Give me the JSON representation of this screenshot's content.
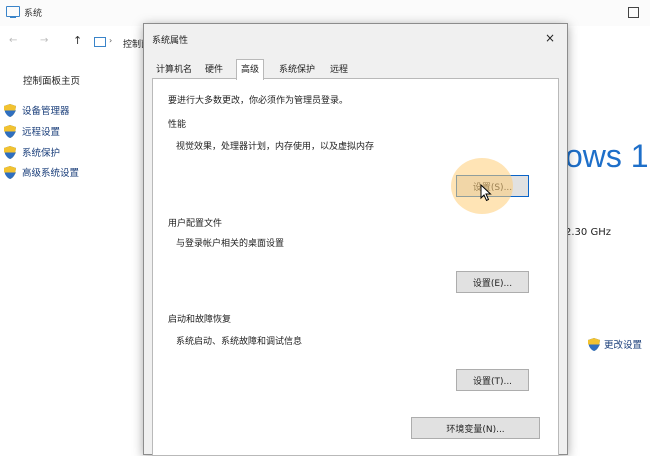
{
  "background": {
    "window_title": "系统",
    "address_text": "控制面板",
    "nav_up": "↑",
    "nav_back": "←",
    "nav_forward": "→",
    "sidebar": {
      "home": "控制面板主页",
      "items": [
        {
          "label": "设备管理器"
        },
        {
          "label": "远程设置"
        },
        {
          "label": "系统保护"
        },
        {
          "label": "高级系统设置"
        }
      ]
    },
    "windows_logo_text": "ows 1",
    "cpu_speed": "2.30 GHz",
    "change_settings": "更改设置"
  },
  "dialog": {
    "title": "系统属性",
    "close": "×",
    "tabs": [
      {
        "label": "计算机名"
      },
      {
        "label": "硬件"
      },
      {
        "label": "高级",
        "active": true
      },
      {
        "label": "系统保护"
      },
      {
        "label": "远程"
      }
    ],
    "admin_note": "要进行大多数更改，你必须作为管理员登录。",
    "performance": {
      "heading": "性能",
      "description": "视觉效果，处理器计划，内存使用，以及虚拟内存",
      "button": "设置(S)..."
    },
    "user_profiles": {
      "heading": "用户配置文件",
      "description": "与登录帐户相关的桌面设置",
      "button": "设置(E)..."
    },
    "startup_recovery": {
      "heading": "启动和故障恢复",
      "description": "系统启动、系统故障和调试信息",
      "button": "设置(T)..."
    },
    "env_button": "环境变量(N)..."
  },
  "colors": {
    "accent": "#0a64c8",
    "link": "#1a3e7a",
    "highlight": "#ffce78"
  }
}
